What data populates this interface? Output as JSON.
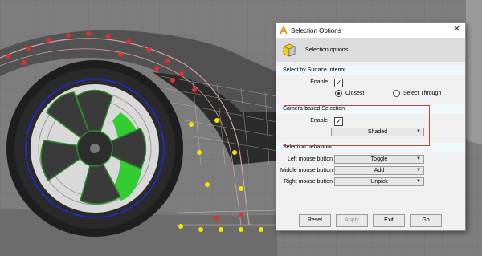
{
  "dialog": {
    "title": "Selection Options",
    "header_text": "Selection options",
    "surface": {
      "heading": "Select by Surface Interior",
      "enable_label": "Enable",
      "enable_checked": true,
      "closest_label": "Closest",
      "select_through_label": "Select Through",
      "selected_mode": "Closest"
    },
    "camera": {
      "heading": "Camera-based Selection",
      "enable_label": "Enable",
      "enable_checked": true,
      "mode_value": "Shaded"
    },
    "behaviour": {
      "heading": "Selection behaviour",
      "left_label": "Left mouse button",
      "left_value": "Toggle",
      "middle_label": "Middle mouse button",
      "middle_value": "Add",
      "right_label": "Right mouse button",
      "right_value": "Unpick"
    },
    "buttons": {
      "reset": "Reset",
      "apply": "Apply",
      "exit": "Exit",
      "go": "Go"
    }
  },
  "colors": {
    "highlight_box": "#d93a3a",
    "section_band": "#eef8fd",
    "viewport_bg": "#7d7d7d",
    "caliper": "#33cc33",
    "cv_points_red": "#e03030",
    "cv_points_yellow": "#f2e600"
  },
  "icons": {
    "app": "alias-a-icon",
    "header": "selection-cube-icon",
    "close": "close-icon",
    "check": "checkmark-icon",
    "dropdown": "triangle-down-icon"
  }
}
